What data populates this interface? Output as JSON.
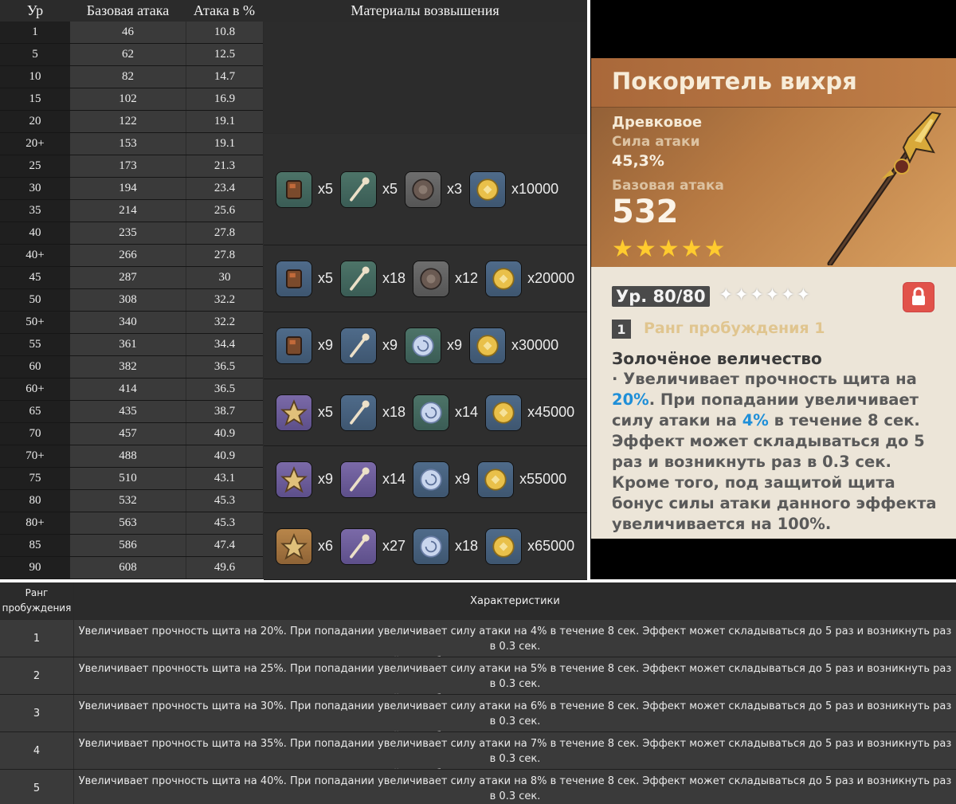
{
  "stats_table": {
    "headers": [
      "Ур",
      "Базовая атака",
      "Атака в %",
      "Материалы возвышения"
    ],
    "rows": [
      {
        "lvl": "1",
        "atk": "46",
        "pct": "10.8"
      },
      {
        "lvl": "5",
        "atk": "62",
        "pct": "12.5"
      },
      {
        "lvl": "10",
        "atk": "82",
        "pct": "14.7"
      },
      {
        "lvl": "15",
        "atk": "102",
        "pct": "16.9"
      },
      {
        "lvl": "20",
        "atk": "122",
        "pct": "19.1"
      },
      {
        "lvl": "20+",
        "atk": "153",
        "pct": "19.1"
      },
      {
        "lvl": "25",
        "atk": "173",
        "pct": "21.3"
      },
      {
        "lvl": "30",
        "atk": "194",
        "pct": "23.4"
      },
      {
        "lvl": "35",
        "atk": "214",
        "pct": "25.6"
      },
      {
        "lvl": "40",
        "atk": "235",
        "pct": "27.8"
      },
      {
        "lvl": "40+",
        "atk": "266",
        "pct": "27.8"
      },
      {
        "lvl": "45",
        "atk": "287",
        "pct": "30"
      },
      {
        "lvl": "50",
        "atk": "308",
        "pct": "32.2"
      },
      {
        "lvl": "50+",
        "atk": "340",
        "pct": "32.2"
      },
      {
        "lvl": "55",
        "atk": "361",
        "pct": "34.4"
      },
      {
        "lvl": "60",
        "atk": "382",
        "pct": "36.5"
      },
      {
        "lvl": "60+",
        "atk": "414",
        "pct": "36.5"
      },
      {
        "lvl": "65",
        "atk": "435",
        "pct": "38.7"
      },
      {
        "lvl": "70",
        "atk": "457",
        "pct": "40.9"
      },
      {
        "lvl": "70+",
        "atk": "488",
        "pct": "40.9"
      },
      {
        "lvl": "75",
        "atk": "510",
        "pct": "43.1"
      },
      {
        "lvl": "80",
        "atk": "532",
        "pct": "45.3"
      },
      {
        "lvl": "80+",
        "atk": "563",
        "pct": "45.3"
      },
      {
        "lvl": "85",
        "atk": "586",
        "pct": "47.4"
      },
      {
        "lvl": "90",
        "atk": "608",
        "pct": "49.6"
      }
    ],
    "materials": [
      [
        {
          "icon": "relic-chunk-icon",
          "color": "green",
          "qty": "x5"
        },
        {
          "icon": "bone-staff-icon",
          "color": "green",
          "qty": "x5"
        },
        {
          "icon": "slime-core-icon",
          "color": "gray",
          "qty": "x3"
        },
        {
          "icon": "mora-coin-icon",
          "color": "blue",
          "qty": "x10000"
        }
      ],
      [
        {
          "icon": "relic-chunk-icon",
          "color": "blue",
          "qty": "x5"
        },
        {
          "icon": "bone-staff-icon",
          "color": "green",
          "qty": "x18"
        },
        {
          "icon": "slime-core-icon",
          "color": "gray",
          "qty": "x12"
        },
        {
          "icon": "mora-coin-icon",
          "color": "blue",
          "qty": "x20000"
        }
      ],
      [
        {
          "icon": "relic-chunk-icon",
          "color": "blue",
          "qty": "x9"
        },
        {
          "icon": "bone-staff-icon",
          "color": "blue",
          "qty": "x9"
        },
        {
          "icon": "spiral-core-icon",
          "color": "green",
          "qty": "x9"
        },
        {
          "icon": "mora-coin-icon",
          "color": "blue",
          "qty": "x30000"
        }
      ],
      [
        {
          "icon": "relic-star-icon",
          "color": "purple",
          "qty": "x5"
        },
        {
          "icon": "bone-staff-icon",
          "color": "blue",
          "qty": "x18"
        },
        {
          "icon": "spiral-core-icon",
          "color": "green",
          "qty": "x14"
        },
        {
          "icon": "mora-coin-icon",
          "color": "blue",
          "qty": "x45000"
        }
      ],
      [
        {
          "icon": "relic-star-icon",
          "color": "purple",
          "qty": "x9"
        },
        {
          "icon": "bone-staff-icon",
          "color": "purple",
          "qty": "x14"
        },
        {
          "icon": "spiral-core-icon",
          "color": "blue",
          "qty": "x9"
        },
        {
          "icon": "mora-coin-icon",
          "color": "blue",
          "qty": "x55000"
        }
      ],
      [
        {
          "icon": "relic-star-icon",
          "color": "gold",
          "qty": "x6"
        },
        {
          "icon": "bone-staff-icon",
          "color": "purple",
          "qty": "x27"
        },
        {
          "icon": "spiral-core-icon",
          "color": "blue",
          "qty": "x18"
        },
        {
          "icon": "mora-coin-icon",
          "color": "blue",
          "qty": "x65000"
        }
      ]
    ]
  },
  "weapon_card": {
    "name": "Покоритель вихря",
    "type": "Древковое",
    "sub_stat_label": "Сила атаки",
    "sub_stat_value": "45,3%",
    "base_atk_label": "Базовая атака",
    "base_atk_value": "532",
    "stars": "★★★★★",
    "level": "Ур. 80/80",
    "ascension_stars": "✦✦✦✦✦✦",
    "refinement_number": "1",
    "refinement_text": "Ранг пробуждения 1",
    "passive_name": "Золочёное величество",
    "passive_parts": {
      "p1": "· Увеличивает прочность щита на ",
      "h1": "20%",
      "p2": ". При попадании увеличивает силу атаки на ",
      "h2": "4%",
      "p3": " в течение 8 сек. Эффект может складываться до 5 раз и возникнуть раз в 0.3 сек. Кроме того, под защитой щита бонус силы атаки данного эффекта увеличивается на 100%."
    }
  },
  "refine_table": {
    "header_rank": "Ранг пробуждения",
    "header_desc": "Характеристики",
    "rows": [
      {
        "rank": "1",
        "line1": "Увеличивает прочность щита на 20%. При попадании увеличивает силу атаки на 4% в течение 8 сек. Эффект может складываться до 5 раз и возникнуть раз в 0.3 сек.",
        "line2": "Кроме того, под защитой щита бонус силы атаки данного эффекта увеличивается на 100%."
      },
      {
        "rank": "2",
        "line1": "Увеличивает прочность щита на 25%. При попадании увеличивает силу атаки на 5% в течение 8 сек. Эффект может складываться до 5 раз и возникнуть раз в 0.3 сек.",
        "line2": "Кроме того, под защитой щита бонус силы атаки данного эффекта увеличивается на 100%."
      },
      {
        "rank": "3",
        "line1": "Увеличивает прочность щита на 30%. При попадании увеличивает силу атаки на 6% в течение 8 сек. Эффект может складываться до 5 раз и возникнуть раз в 0.3 сек.",
        "line2": "Кроме того, под защитой щита бонус силы атаки данного эффекта увеличивается на 100%."
      },
      {
        "rank": "4",
        "line1": "Увеличивает прочность щита на 35%. При попадании увеличивает силу атаки на 7% в течение 8 сек. Эффект может складываться до 5 раз и возникнуть раз в 0.3 сек.",
        "line2": "Кроме того, под защитой щита бонус силы атаки данного эффекта увеличивается на 100%."
      },
      {
        "rank": "5",
        "line1": "Увеличивает прочность щита на 40%. При попадании увеличивает силу атаки на 8% в течение 8 сек. Эффект может складываться до 5 раз и возникнуть раз в 0.3 сек.",
        "line2": "Кроме того, под защитой щита бонус силы атаки данного эффекта увеличивается на 100%."
      }
    ]
  }
}
